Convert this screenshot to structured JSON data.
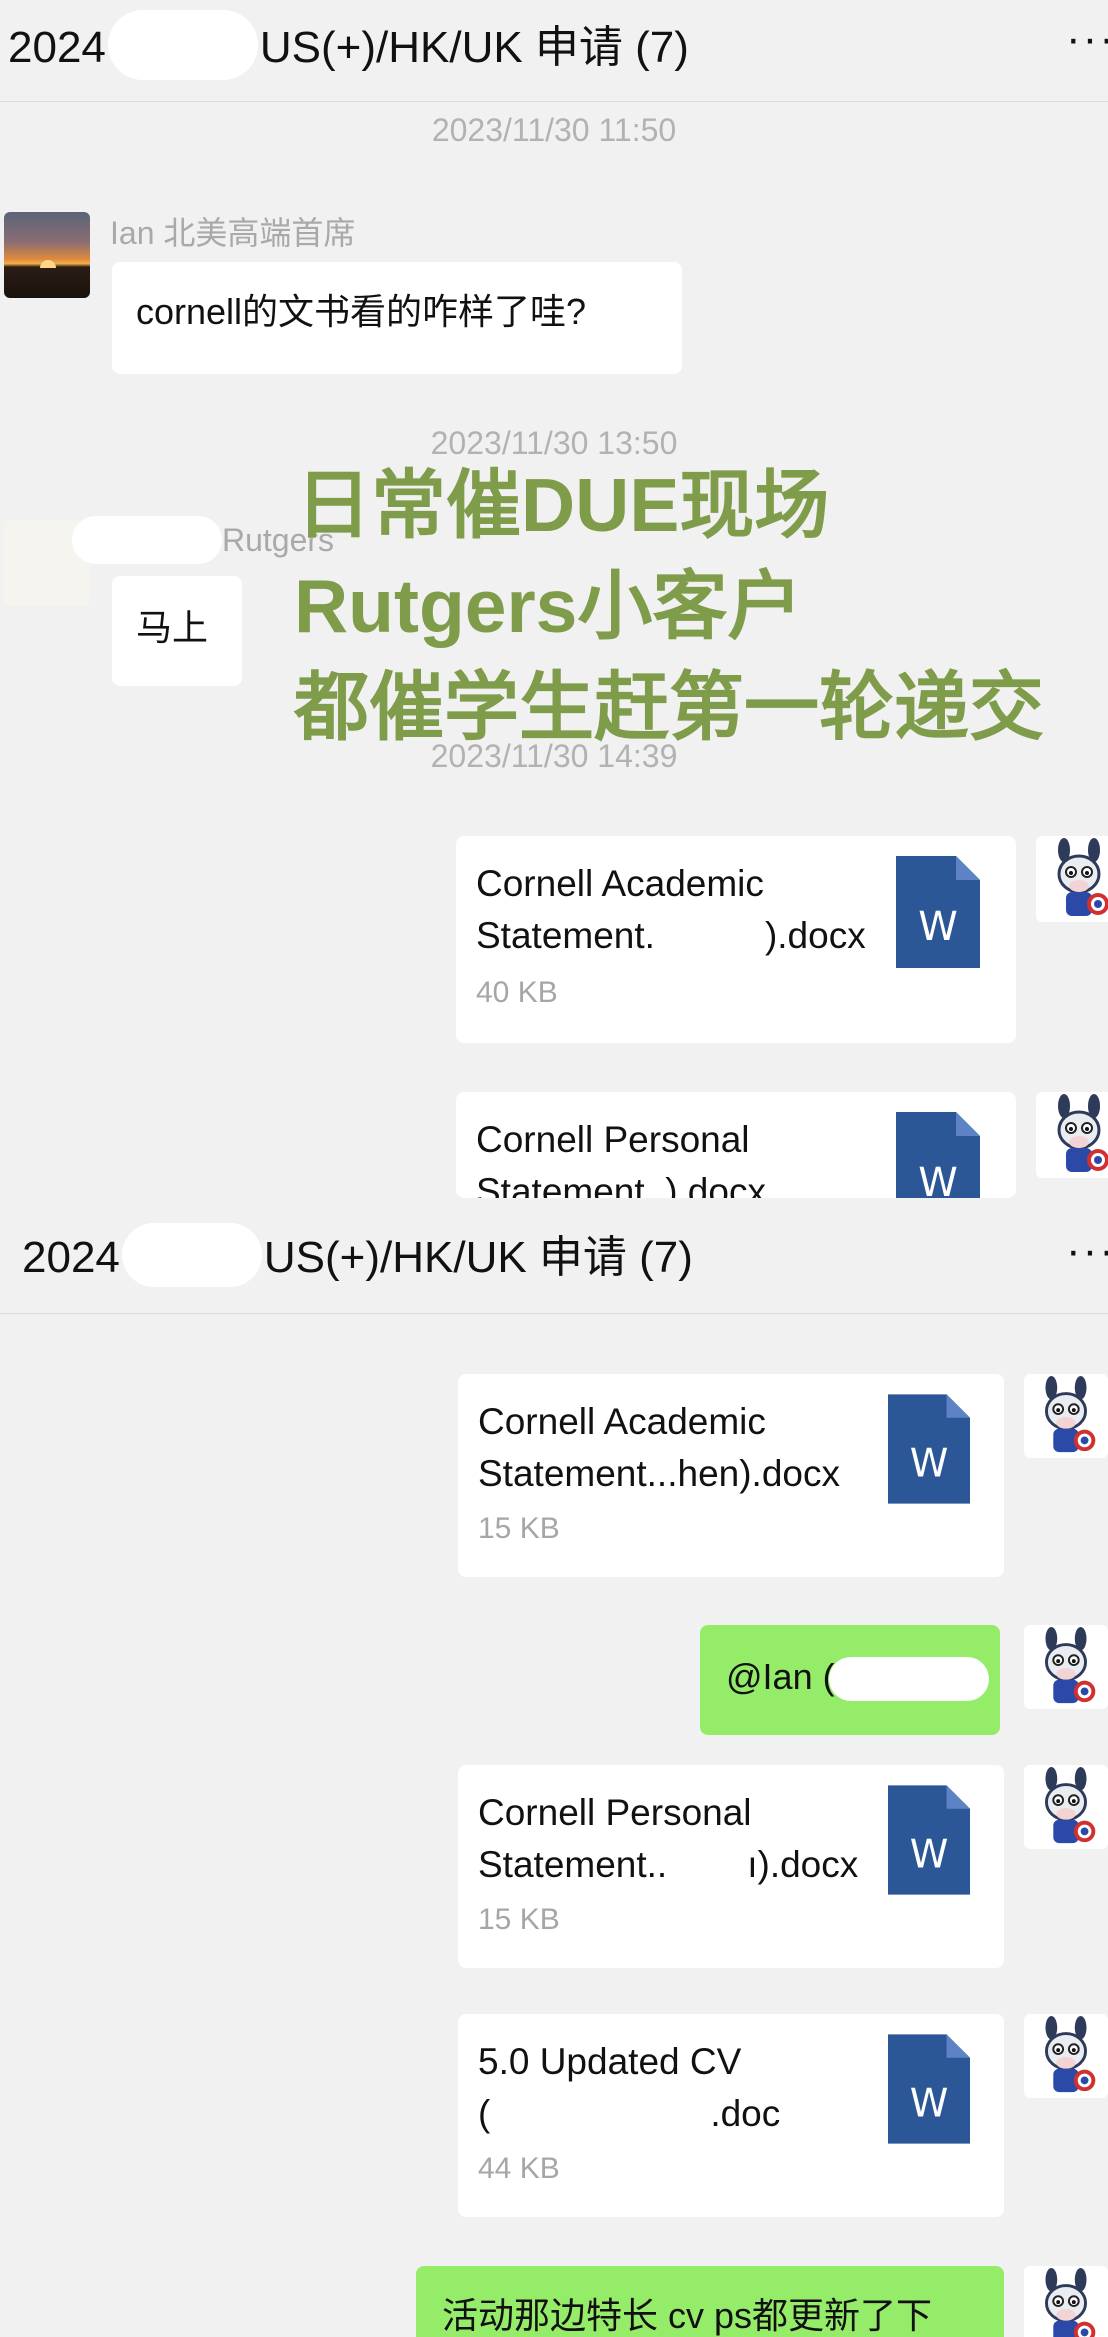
{
  "screen1": {
    "header": {
      "year": "2024",
      "title_rest": "US(+)/HK/UK 申请 (7)",
      "more": "···"
    },
    "time1": "2023/11/30 11:50",
    "sender1": "Ian 北美高端首席",
    "msg1": "cornell的文书看的咋样了哇?",
    "time2": "2023/11/30 13:50",
    "sender2": "Rutgers",
    "msg2": "马上",
    "time3": "2023/11/30 14:39",
    "file1": {
      "line1": "Cornell Academic",
      "line2a": "Statement.",
      "line2b": ").docx",
      "size": "40 KB",
      "icon_label": "W"
    },
    "file2": {
      "line1": "Cornell Personal",
      "line2": "Statement.    ).docx",
      "icon_label": "W"
    }
  },
  "overlay": {
    "line1": "日常催DUE现场",
    "line2": "Rutgers小客户",
    "line3": "都催学生赶第一轮递交"
  },
  "screen2": {
    "header": {
      "year": "2024",
      "title_rest": "US(+)/HK/UK 申请 (7)",
      "more": "···"
    },
    "file1": {
      "line1": "Cornell Academic",
      "line2": "Statement...hen).docx",
      "size": "15 KB",
      "icon_label": "W"
    },
    "mention": "@Ian (",
    "file2": {
      "line1": "Cornell Personal",
      "line2a": "Statement..",
      "line2b": "ı).docx",
      "size": "15 KB",
      "icon_label": "W"
    },
    "file3": {
      "line1": "5.0 Updated CV",
      "line2a": "(",
      "line2b": ".doc",
      "size": "44 KB",
      "icon_label": "W"
    },
    "msg_last": "活动那边特长 cv ps都更新了下"
  },
  "colors": {
    "green_bubble": "#95ec69",
    "word_blue": "#2b5797",
    "overlay_text": "#7f9c4a",
    "timestamp": "#b2b2b2"
  },
  "icons": [
    "more-icon",
    "word-doc-icon",
    "donkey-avatar-icon",
    "sunset-avatar"
  ]
}
